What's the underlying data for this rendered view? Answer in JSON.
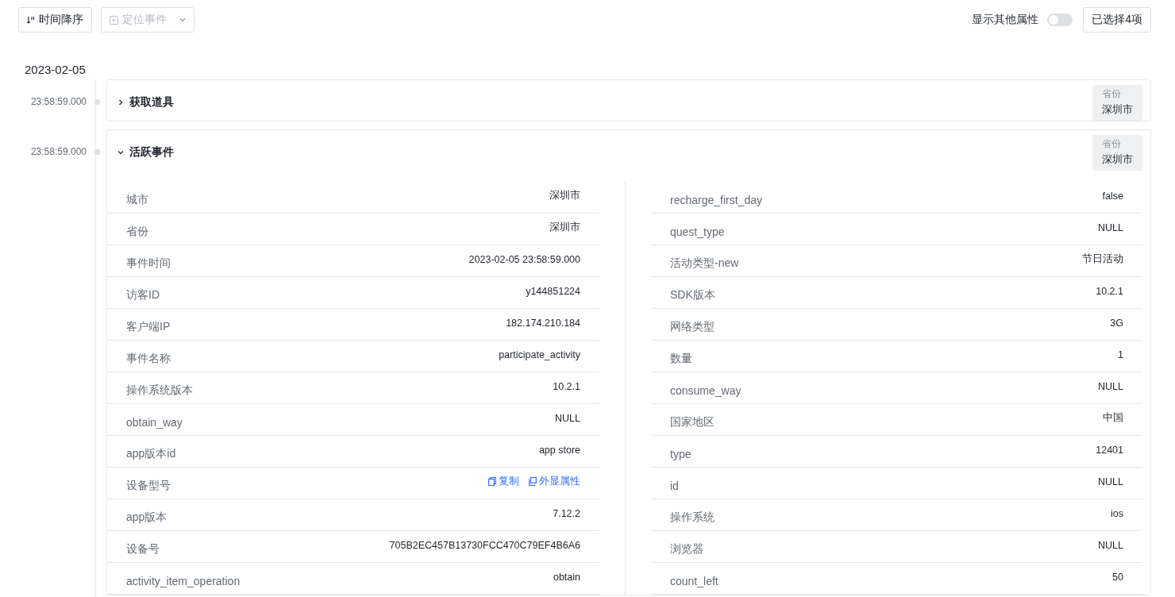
{
  "toolbar": {
    "sort_button": "时间降序",
    "locate_select": {
      "placeholder": "定位事件",
      "disabled": true
    },
    "toggle": {
      "label": "显示其他属性",
      "on": false
    },
    "selected_button": "已选择4项"
  },
  "date": "2023-02-05",
  "events": [
    {
      "time": "23:58:59.000",
      "name": "获取道具",
      "expanded": false,
      "tag": {
        "label": "省份",
        "value": "深圳市"
      }
    },
    {
      "time": "23:58:59.000",
      "name": "活跃事件",
      "expanded": true,
      "tag": {
        "label": "省份",
        "value": "深圳市"
      },
      "left": [
        {
          "kind": "value",
          "name": "城市",
          "value": "深圳市"
        },
        {
          "kind": "value",
          "name": "省份",
          "value": "深圳市"
        },
        {
          "kind": "value",
          "name": "事件时间",
          "value": "2023-02-05 23:58:59.000"
        },
        {
          "kind": "value",
          "name": "访客ID",
          "value": "y144851224"
        },
        {
          "kind": "value",
          "name": "客户端IP",
          "value": "182.174.210.184"
        },
        {
          "kind": "value",
          "name": "事件名称",
          "value": "participate_activity"
        },
        {
          "kind": "value",
          "name": "操作系统版本",
          "value": "10.2.1"
        },
        {
          "kind": "value",
          "name": "obtain_way",
          "value": "NULL"
        },
        {
          "kind": "value",
          "name": "app版本id",
          "value": "app store"
        },
        {
          "kind": "actions",
          "name": "设备型号",
          "actions": [
            "复制",
            "外显属性"
          ]
        },
        {
          "kind": "value",
          "name": "app版本",
          "value": "7.12.2"
        },
        {
          "kind": "value",
          "name": "设备号",
          "value": "705B2EC457B13730FCC470C79EF4B6A6"
        },
        {
          "kind": "value",
          "name": "activity_item_operation",
          "value": "obtain"
        }
      ],
      "right": [
        {
          "kind": "value",
          "name": "recharge_first_day",
          "value": "false"
        },
        {
          "kind": "value",
          "name": "quest_type",
          "value": "NULL"
        },
        {
          "kind": "value",
          "name": "活动类型-new",
          "value": "节日活动"
        },
        {
          "kind": "value",
          "name": "SDK版本",
          "value": "10.2.1"
        },
        {
          "kind": "value",
          "name": "网络类型",
          "value": "3G"
        },
        {
          "kind": "value",
          "name": "数量",
          "value": "1"
        },
        {
          "kind": "value",
          "name": "consume_way",
          "value": "NULL"
        },
        {
          "kind": "value",
          "name": "国家地区",
          "value": "中国"
        },
        {
          "kind": "value",
          "name": "type",
          "value": "12401"
        },
        {
          "kind": "value",
          "name": "id",
          "value": "NULL"
        },
        {
          "kind": "value",
          "name": "操作系统",
          "value": "ios"
        },
        {
          "kind": "value",
          "name": "浏览器",
          "value": "NULL"
        },
        {
          "kind": "value",
          "name": "count_left",
          "value": "50"
        }
      ]
    }
  ]
}
